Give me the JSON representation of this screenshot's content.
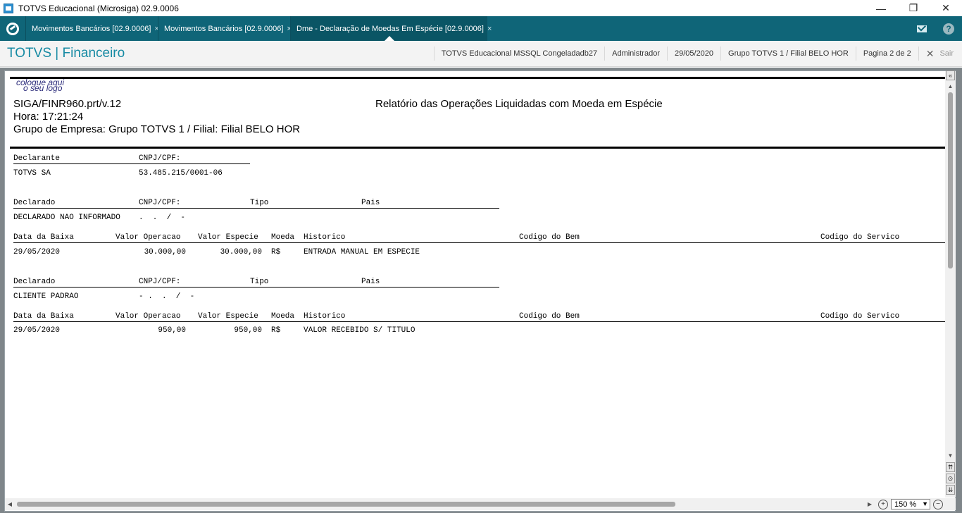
{
  "window": {
    "title": "TOTVS Educacional (Microsiga) 02.9.0006",
    "minimize": "—",
    "restore": "❐",
    "close": "✕"
  },
  "tabs": [
    {
      "label": "Movimentos Bancários [02.9.0006]",
      "close": "×"
    },
    {
      "label": "Movimentos Bancários [02.9.0006]",
      "close": "×"
    },
    {
      "label": "Dme - Declaração de Moedas Em Espécie [02.9.0006]",
      "close": "×"
    }
  ],
  "header": {
    "brand": "TOTVS | Financeiro",
    "environment": "TOTVS Educacional MSSQL Congeladadb27",
    "user": "Administrador",
    "date": "29/05/2020",
    "company": "Grupo TOTVS 1 / Filial BELO HOR",
    "page": "Pagina 2 de 2",
    "exit": "Sair"
  },
  "report": {
    "logo_line1": "coloque aqui",
    "logo_line2": "o seu logo",
    "program": "SIGA/FINR960.prt/v.12",
    "time": "Hora: 17:21:24",
    "group": "Grupo de Empresa: Grupo TOTVS 1 / Filial: Filial BELO HOR",
    "title": "Relatório das Operações Liquidadas com Moeda em Espécie",
    "declarante_header": "Declarante",
    "declarante_cnpj_header": "CNPJ/CPF:",
    "declarante_name": "TOTVS SA",
    "declarante_cnpj": "53.485.215/0001-06",
    "declarado_header": "Declarado",
    "cnpj_header": "CNPJ/CPF:",
    "tipo_header": "Tipo",
    "pais_header": "Pais",
    "columns": {
      "data_baixa": "Data da Baixa",
      "valor_operacao": "Valor Operacao",
      "valor_especie": "Valor Especie",
      "moeda": "Moeda",
      "historico": "Historico",
      "codigo_bem": "Codigo do Bem",
      "codigo_servico": "Codigo do Servico"
    },
    "blocks": [
      {
        "declarado": "DECLARADO NAO INFORMADO",
        "cnpj": ".  .  /  -",
        "row": {
          "data": "29/05/2020",
          "valor_operacao": "30.000,00",
          "valor_especie": "30.000,00",
          "moeda": "R$",
          "historico": "ENTRADA MANUAL EM ESPECIE"
        }
      },
      {
        "declarado": "CLIENTE PADRAO",
        "cnpj": "- .  .  /  -",
        "row": {
          "data": "29/05/2020",
          "valor_operacao": "950,00",
          "valor_especie": "950,00",
          "moeda": "R$",
          "historico": "VALOR RECEBIDO S/ TITULO"
        }
      }
    ]
  },
  "zoom": {
    "value": "150 %"
  }
}
